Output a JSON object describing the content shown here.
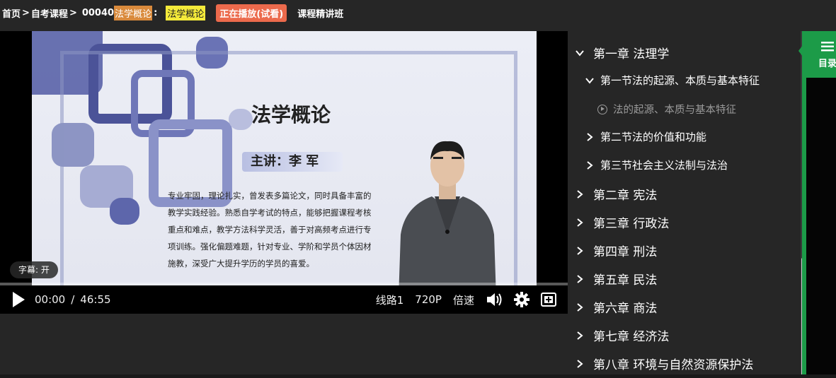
{
  "breadcrumb": {
    "home": "首页",
    "sep": ">",
    "category": "自考课程",
    "sep2": ">",
    "course_code": "00040",
    "course_name_highlight": "法学概论",
    "colon": ":",
    "course_name_tag": "法学概论",
    "status_badge": "正在播放(试看)",
    "course_type": "课程精讲班"
  },
  "slide": {
    "title": "法学概论",
    "lecturer": "主讲：李 军",
    "bio_lines": [
      "专业牢固，理论扎实，曾发表多篇论文，同时具备丰富的",
      "教学实践经验。熟悉自学考试的特点，能够把握课程考核",
      "重点和难点，教学方法科学灵活，善于对高频考点进行专",
      "项训练。强化偏题难题，针对专业、学阶和学员个体因材",
      "施教，深受广大提升学历的学员的喜爱。"
    ]
  },
  "player": {
    "subtitle_toggle": "字幕: 开",
    "current_time": "00:00",
    "time_sep": "/",
    "duration": "46:55",
    "line_label": "线路1",
    "quality_label": "720P",
    "speed_label": "倍速",
    "progress": 0.0,
    "icons": [
      "play-icon",
      "volume-icon",
      "gear-icon",
      "fullscreen-icon"
    ]
  },
  "chapters": {
    "items": [
      {
        "level": 1,
        "label": "第一章 法理学",
        "expanded": true
      },
      {
        "level": 2,
        "label": "第一节法的起源、本质与基本特征",
        "expanded": true
      },
      {
        "level": 3,
        "label": "法的起源、本质与基本特征"
      },
      {
        "level": 2,
        "label": "第二节法的价值和功能",
        "expanded": false
      },
      {
        "level": 2,
        "label": "第三节社会主义法制与法治",
        "expanded": false
      },
      {
        "level": 1,
        "label": "第二章 宪法",
        "expanded": false
      },
      {
        "level": 1,
        "label": "第三章 行政法",
        "expanded": false
      },
      {
        "level": 1,
        "label": "第四章 刑法",
        "expanded": false
      },
      {
        "level": 1,
        "label": "第五章 民法",
        "expanded": false
      },
      {
        "level": 1,
        "label": "第六章 商法",
        "expanded": false
      },
      {
        "level": 1,
        "label": "第七章 经济法",
        "expanded": false
      },
      {
        "level": 1,
        "label": "第八章 环境与自然资源保护法",
        "expanded": false
      }
    ]
  },
  "sidebar_tab": {
    "label": "目录",
    "icon": "menu-icon"
  },
  "colors": {
    "accent_green": "#1c9b48",
    "badge_orange": "#ec6a4c",
    "highlight_yellow": "#f4ea3a",
    "highlight_orange": "#d98a3c"
  }
}
